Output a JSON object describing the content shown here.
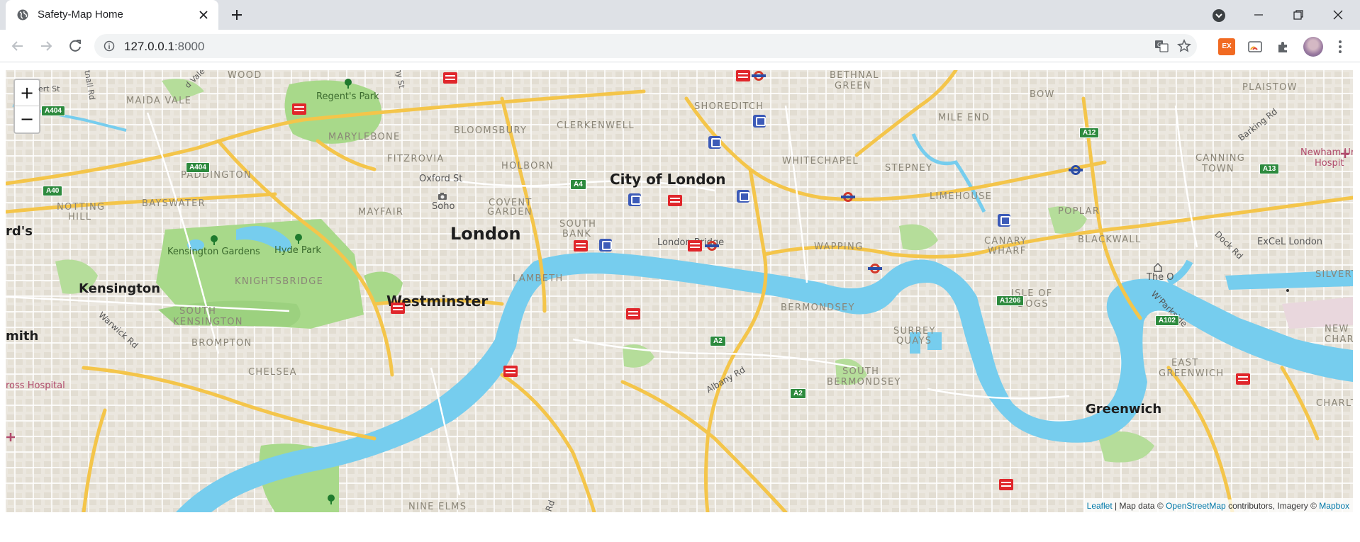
{
  "browser": {
    "tab_title": "Safety-Map Home",
    "url_host": "127.0.0.1",
    "url_port": ":8000",
    "ext_label": "EX"
  },
  "map": {
    "zoom_in": "+",
    "zoom_out": "−",
    "labels": {
      "wood": "WOOD",
      "regents_park": "Regent's Park",
      "maida_vale": "MAIDA VALE",
      "marylebone": "MARYLEBONE",
      "bloomsbury": "BLOOMSBURY",
      "clerkenwell": "CLERKENWELL",
      "shoreditch": "SHOREDITCH",
      "bethnal_green_1": "BETHNAL",
      "bethnal_green_2": "GREEN",
      "bow": "BOW",
      "plaistow": "PLAISTOW",
      "mile_end": "MILE END",
      "fitzrovia": "FITZROVIA",
      "paddington": "PADDINGTON",
      "holborn": "HOLBORN",
      "city_of_london": "City of London",
      "whitechapel": "WHITECHAPEL",
      "stepney": "STEPNEY",
      "canning_town_1": "CANNING",
      "canning_town_2": "TOWN",
      "newham_1": "Newham Ur",
      "newham_2": "Hospit",
      "oxford_st": "Oxford St",
      "soho": "Soho",
      "covent_1": "COVENT",
      "covent_2": "GARDEN",
      "bayswater": "BAYSWATER",
      "notting_1": "NOTTING",
      "notting_2": "HILL",
      "mayfair": "MAYFAIR",
      "limehouse": "LIMEHOUSE",
      "poplar": "POPLAR",
      "london": "London",
      "south_bank_1": "SOUTH",
      "south_bank_2": "BANK",
      "london_bridge": "London Bridge",
      "wapping": "WAPPING",
      "canary_1": "CANARY",
      "canary_2": "WHARF",
      "blackwall": "BLACKWALL",
      "excel": "ExCeL London",
      "kensington_gardens": "Kensington Gardens",
      "hyde_park": "Hyde Park",
      "the_o2": "The O",
      "silvertown": "SILVERT",
      "kensington": "Kensington",
      "knightsbridge": "KNIGHTSBRIDGE",
      "lambeth": "LAMBETH",
      "westminster": "Westminster",
      "bermondsey": "BERMONDSEY",
      "isle_1": "ISLE OF",
      "isle_2": "DOGS",
      "south_ken_1": "SOUTH",
      "south_ken_2": "KENSINGTON",
      "brompton": "BROMPTON",
      "surrey_1": "SURREY",
      "surrey_2": "QUAYS",
      "new_charlton_1": "NEW",
      "new_charlton_2": "CHARLT",
      "hammersmith": "mith",
      "ards": "rd's",
      "chelsea": "CHELSEA",
      "south_berm_1": "SOUTH",
      "south_berm_2": "BERMONDSEY",
      "east_green_1": "EAST",
      "east_green_2": "GREENWICH",
      "cross_hospital": "ross Hospital",
      "greenwich": "Greenwich",
      "charlton": "CHARLTO",
      "nine_elms": "NINE ELMS",
      "warwick_rd": "Warwick Rd",
      "albany_rd": "Albany Rd",
      "dock_rd": "Dock Rd",
      "westferry": "W'Parkside",
      "barking_rd": "Barking Rd",
      "portnall": "Portnall Rd",
      "bert": "ert St",
      "ny_st": "ny St",
      "vale": "d Vale",
      "rd_bottom": "Rd"
    },
    "shields": {
      "a404_top": "A404",
      "a404": "A404",
      "a40": "A40",
      "a4": "A4",
      "a12": "A12",
      "a13": "A13",
      "a1206": "A1206",
      "a102": "A102",
      "a2_1": "A2",
      "a2_2": "A2"
    },
    "attribution": {
      "leaflet": "Leaflet",
      "sep": " | Map data © ",
      "osm": "OpenStreetMap",
      "mid": " contributors, Imagery © ",
      "mapbox": "Mapbox"
    }
  }
}
